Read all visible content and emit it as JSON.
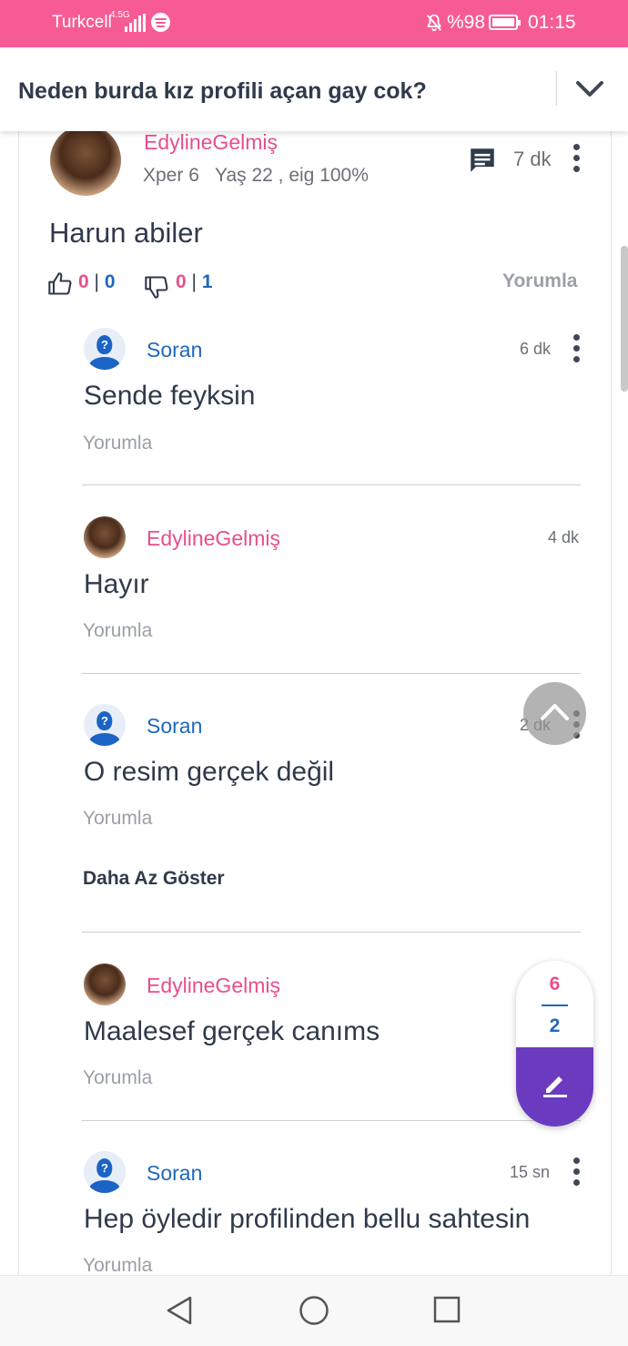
{
  "status_bar": {
    "carrier": "Turkcell",
    "network": "4.5G",
    "battery": "%98",
    "time": "01:15"
  },
  "header": {
    "title": "Neden burda kız profili açan gay cok?"
  },
  "answer": {
    "author": "EdylineGelmiş",
    "xper": "Xper 6",
    "age": "Yaş 22 , eig 100%",
    "time": "7 dk",
    "text": "Harun abiler",
    "likes_a": "0",
    "likes_b": "0",
    "dislikes_a": "0",
    "dislikes_b": "1",
    "reply_label": "Yorumla"
  },
  "comments": [
    {
      "author": "Soran",
      "time": "6 dk",
      "text": "Sende feyksin",
      "reply_label": "Yorumla"
    },
    {
      "author": "EdylineGelmiş",
      "time": "4 dk",
      "text": "Hayır",
      "reply_label": "Yorumla"
    },
    {
      "author": "Soran",
      "time": "2 dk",
      "text": "O resim gerçek değil",
      "reply_label": "Yorumla"
    },
    {
      "author": "EdylineGelmiş",
      "time": "",
      "text": "Maalesef gerçek canıms",
      "reply_label": "Yorumla"
    },
    {
      "author": "Soran",
      "time": "15 sn",
      "text": "Hep öyledir profilinden bellu sahtesin",
      "reply_label": "Yorumla"
    }
  ],
  "show_less_label": "Daha Az Göster",
  "floating_counter": {
    "top": "6",
    "bottom": "2"
  },
  "colors": {
    "accent_pink": "#e64f8c",
    "accent_blue": "#1f68b9",
    "status_bar": "#f75b93",
    "write_button": "#6a3bbf"
  }
}
